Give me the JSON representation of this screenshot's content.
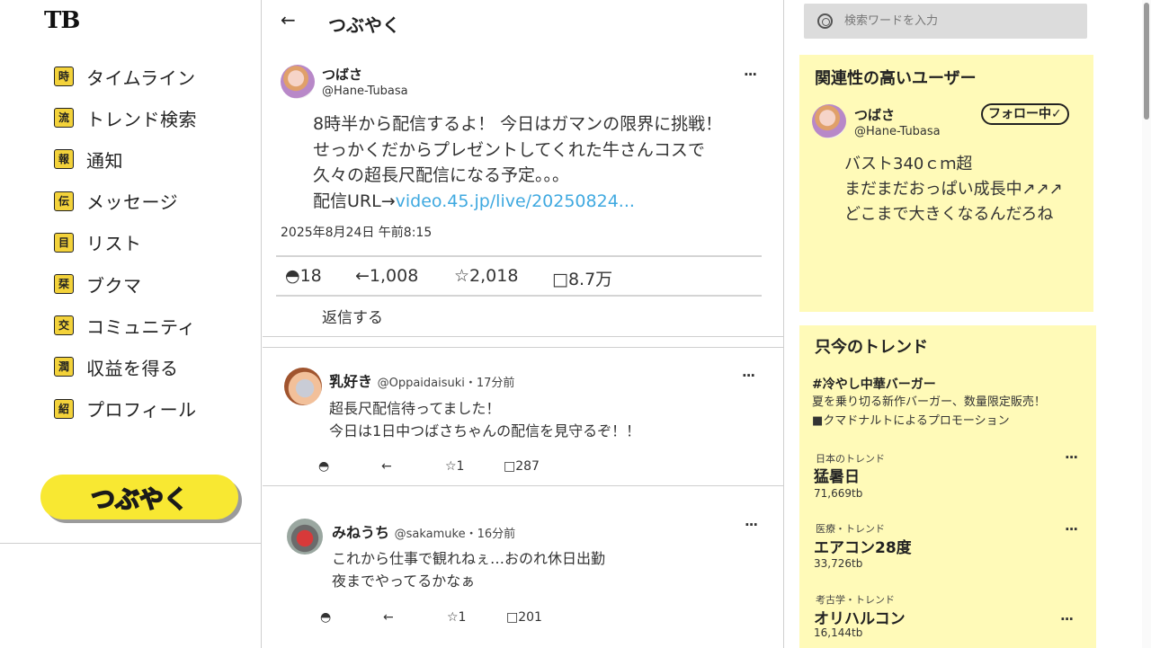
{
  "logo": "TB",
  "nav": {
    "items": [
      {
        "badge": "時",
        "label": "タイムライン"
      },
      {
        "badge": "流",
        "label": "トレンド検索"
      },
      {
        "badge": "報",
        "label": "通知"
      },
      {
        "badge": "伝",
        "label": "メッセージ"
      },
      {
        "badge": "目",
        "label": "リスト"
      },
      {
        "badge": "栞",
        "label": "ブクマ"
      },
      {
        "badge": "交",
        "label": "コミュニティ"
      },
      {
        "badge": "潤",
        "label": "収益を得る"
      },
      {
        "badge": "紹",
        "label": "プロフィール"
      }
    ],
    "post_button": "つぶやく"
  },
  "header": {
    "back": "←",
    "title": "つぶやく"
  },
  "tweet": {
    "name": "つばさ",
    "handle": "@Hane-Tubasa",
    "more": "···",
    "lines": [
      "8時半から配信するよ！ 今日はガマンの限界に挑戦！",
      "せっかくだからプレゼントしてくれた牛さんコスで",
      "久々の超長尺配信になる予定。。。"
    ],
    "link_prefix": "配信URL→",
    "link_text": "video.45.jp/live/20250824...",
    "date": "2025年8月24日 午前8:15",
    "stats": {
      "replies": "◓18",
      "reposts": "←1,008",
      "likes": "☆2,018",
      "views": "□8.7万"
    },
    "reply_label": "返信する"
  },
  "replies": [
    {
      "name": "乳好き",
      "meta": "@Oppaidaisuki・17分前",
      "more": "···",
      "lines": [
        "超長尺配信待ってました！",
        "今日は1日中つばさちゃんの配信を見守るぞ！！"
      ],
      "reply": "◓",
      "repost": "←",
      "like": "☆1",
      "view": "□287"
    },
    {
      "name": "みねうち",
      "meta": "@sakamuke・16分前",
      "more": "···",
      "lines": [
        "これから仕事で観れねぇ…おのれ休日出勤",
        "夜までやってるかなぁ"
      ],
      "reply": "◓",
      "repost": "←",
      "like": "☆1",
      "view": "□201"
    }
  ],
  "search": {
    "placeholder": "検索ワードを入力"
  },
  "related": {
    "title": "関連性の高いユーザー",
    "name": "つばさ",
    "handle": "@Hane-Tubasa",
    "follow": "フォロー中✓",
    "bio": [
      "バスト340ｃｍ超",
      "まだまだおっぱい成長中↗↗↗",
      "どこまで大きくなるんだろね"
    ]
  },
  "trends": {
    "title": "只今のトレンド",
    "promo": {
      "tag": "#冷やし中華バーガー",
      "desc": "夏を乗り切る新作バーガー、数量限定販売！",
      "sponsor": "■クマドナルトによるプロモーション"
    },
    "items": [
      {
        "category": "日本のトレンド",
        "name": "猛暑日",
        "count": "71,669tb",
        "more": "···"
      },
      {
        "category": "医療・トレンド",
        "name": "エアコン28度",
        "count": "33,726tb",
        "more": "···"
      },
      {
        "category": "考古学・トレンド",
        "name": "オリハルコン",
        "count": "16,144tb",
        "more": "···"
      }
    ]
  }
}
